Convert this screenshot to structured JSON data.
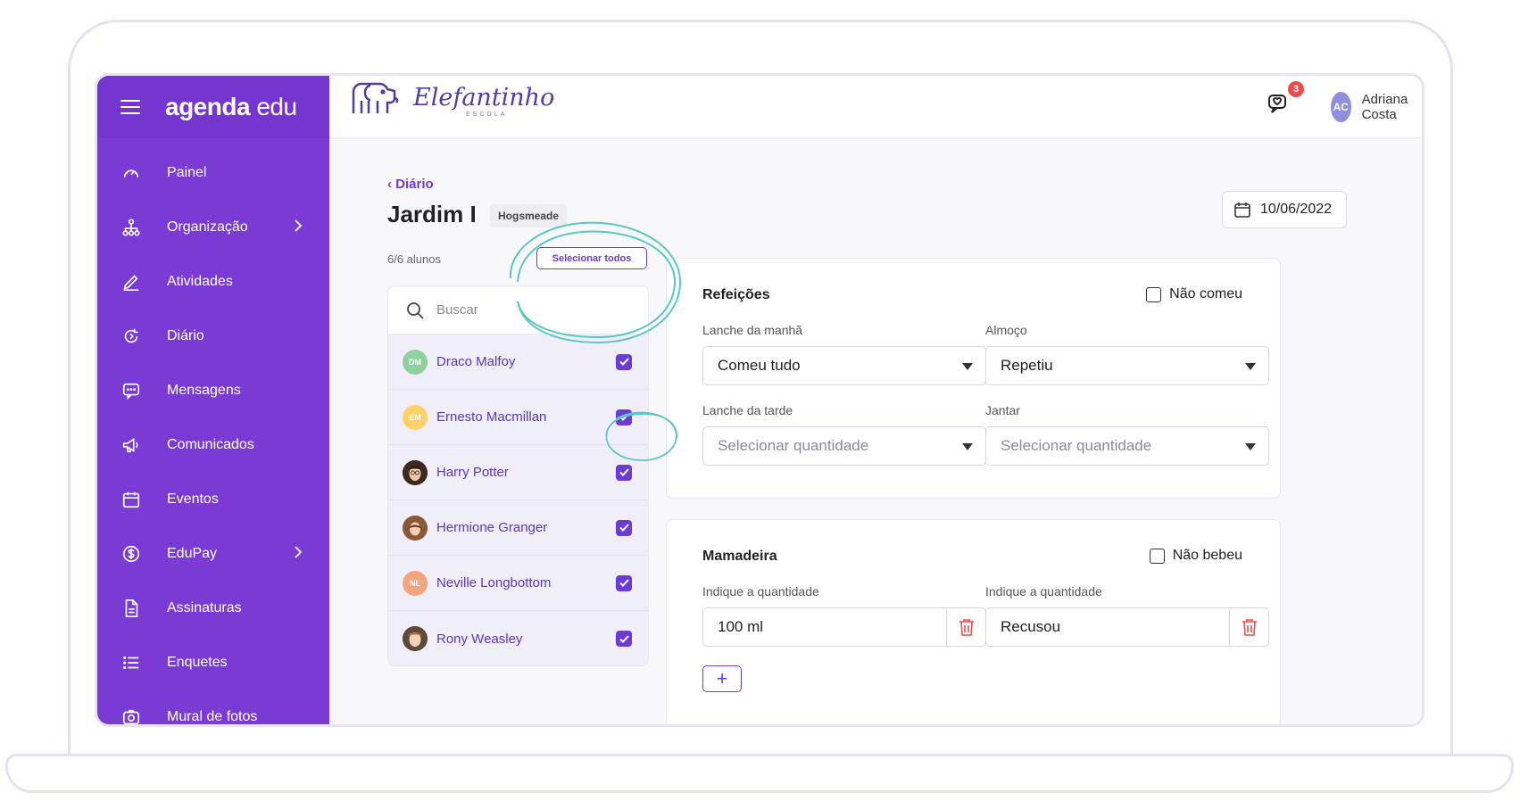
{
  "app": {
    "brand_bold": "agenda",
    "brand_light": "edu"
  },
  "school": {
    "name": "Elefantinho",
    "subtitle": "ESCOLA"
  },
  "sidebar": {
    "items": [
      {
        "label": "Painel",
        "icon": "gauge-icon"
      },
      {
        "label": "Organização",
        "icon": "org-chart-icon",
        "has_submenu": true
      },
      {
        "label": "Atividades",
        "icon": "pencil-icon"
      },
      {
        "label": "Diário",
        "icon": "refresh-icon"
      },
      {
        "label": "Mensagens",
        "icon": "chat-icon"
      },
      {
        "label": "Comunicados",
        "icon": "megaphone-icon"
      },
      {
        "label": "Eventos",
        "icon": "calendar-icon"
      },
      {
        "label": "EduPay",
        "icon": "dollar-icon",
        "has_submenu": true
      },
      {
        "label": "Assinaturas",
        "icon": "document-icon"
      },
      {
        "label": "Enquetes",
        "icon": "list-icon"
      },
      {
        "label": "Mural de fotos",
        "icon": "camera-icon"
      }
    ]
  },
  "header": {
    "notification_count": "3",
    "user_initials": "AC",
    "user_name": "Adriana Costa"
  },
  "page": {
    "back_label": "Diário",
    "title": "Jardim I",
    "group_badge": "Hogsmeade",
    "student_count": "6/6 alunos",
    "select_all_label": "Selecionar todos",
    "date": "10/06/2022"
  },
  "search": {
    "placeholder": "Buscar"
  },
  "students": [
    {
      "name": "Draco Malfoy",
      "initials": "DM",
      "color": "#8fd19e",
      "checked": true
    },
    {
      "name": "Ernesto Macmillan",
      "initials": "EM",
      "color": "#ffd166",
      "checked": true
    },
    {
      "name": "Harry Potter",
      "initials": "",
      "color": "#5a4636",
      "checked": true
    },
    {
      "name": "Hermione Granger",
      "initials": "",
      "color": "#a0704a",
      "checked": true
    },
    {
      "name": "Neville Longbottom",
      "initials": "NL",
      "color": "#f4a57c",
      "checked": true
    },
    {
      "name": "Rony Weasley",
      "initials": "",
      "color": "#7a5a44",
      "checked": true
    }
  ],
  "meals": {
    "title": "Refeições",
    "not_eaten_label": "Não comeu",
    "fields": [
      {
        "label": "Lanche da manhã",
        "value": "Comeu tudo",
        "placeholder": false
      },
      {
        "label": "Almoço",
        "value": "Repetiu",
        "placeholder": false
      },
      {
        "label": "Lanche da tarde",
        "value": "Selecionar quantidade",
        "placeholder": true
      },
      {
        "label": "Jantar",
        "value": "Selecionar quantidade",
        "placeholder": true
      }
    ]
  },
  "bottle": {
    "title": "Mamadeira",
    "not_drunk_label": "Não bebeu",
    "fields": [
      {
        "label": "Indique a quantidade",
        "value": "100 ml"
      },
      {
        "label": "Indique a quantidade",
        "value": "Recusou"
      }
    ],
    "add_label": "+"
  },
  "colors": {
    "primary": "#7a3bd5",
    "accent": "#6c3bd6",
    "annotation": "#5ac8c0",
    "danger": "#ef4b4b"
  }
}
